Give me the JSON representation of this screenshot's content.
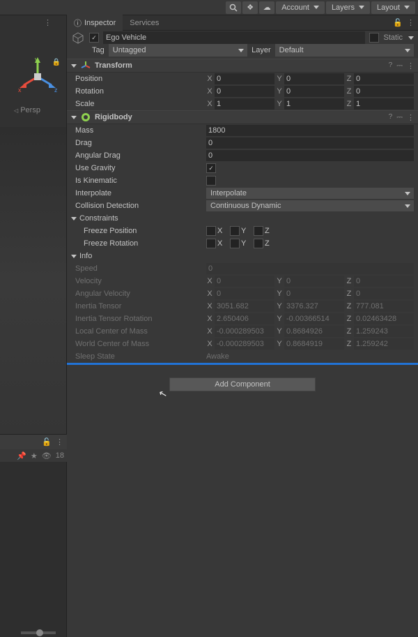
{
  "topbar": {
    "account": "Account",
    "layers": "Layers",
    "layout": "Layout"
  },
  "tabs": {
    "inspector": "Inspector",
    "services": "Services"
  },
  "gameobject": {
    "name": "Ego Vehicle",
    "static_label": "Static",
    "tag_label": "Tag",
    "tag_value": "Untagged",
    "layer_label": "Layer",
    "layer_value": "Default"
  },
  "transform": {
    "title": "Transform",
    "position_label": "Position",
    "rotation_label": "Rotation",
    "scale_label": "Scale",
    "position": {
      "x": "0",
      "y": "0",
      "z": "0"
    },
    "rotation": {
      "x": "0",
      "y": "0",
      "z": "0"
    },
    "scale": {
      "x": "1",
      "y": "1",
      "z": "1"
    }
  },
  "rigidbody": {
    "title": "Rigidbody",
    "mass_label": "Mass",
    "mass": "1800",
    "drag_label": "Drag",
    "drag": "0",
    "angular_drag_label": "Angular Drag",
    "angular_drag": "0",
    "use_gravity_label": "Use Gravity",
    "use_gravity": true,
    "is_kinematic_label": "Is Kinematic",
    "is_kinematic": false,
    "interpolate_label": "Interpolate",
    "interpolate": "Interpolate",
    "collision_label": "Collision Detection",
    "collision": "Continuous Dynamic",
    "constraints_label": "Constraints",
    "freeze_position_label": "Freeze Position",
    "freeze_rotation_label": "Freeze Rotation",
    "axes": {
      "x": "X",
      "y": "Y",
      "z": "Z"
    },
    "info_label": "Info",
    "speed_label": "Speed",
    "speed": "0",
    "velocity_label": "Velocity",
    "velocity": {
      "x": "0",
      "y": "0",
      "z": "0"
    },
    "angular_velocity_label": "Angular Velocity",
    "angular_velocity": {
      "x": "0",
      "y": "0",
      "z": "0"
    },
    "inertia_tensor_label": "Inertia Tensor",
    "inertia_tensor": {
      "x": "3051.682",
      "y": "3376.327",
      "z": "777.081"
    },
    "inertia_tensor_rotation_label": "Inertia Tensor Rotation",
    "inertia_tensor_rotation": {
      "x": "2.650406",
      "y": "-0.00366514",
      "z": "0.02463428"
    },
    "local_com_label": "Local Center of Mass",
    "local_com": {
      "x": "-0.000289503",
      "y": "0.8684926",
      "z": "1.259243"
    },
    "world_com_label": "World Center of Mass",
    "world_com": {
      "x": "-0.000289503",
      "y": "0.8684919",
      "z": "1.259242"
    },
    "sleep_state_label": "Sleep State",
    "sleep_state": "Awake"
  },
  "buttons": {
    "add_component": "Add Component"
  },
  "scene": {
    "persp": "Persp",
    "axis_x": "x",
    "axis_y": "y",
    "axis_z": "z",
    "visibility_count": "18"
  }
}
